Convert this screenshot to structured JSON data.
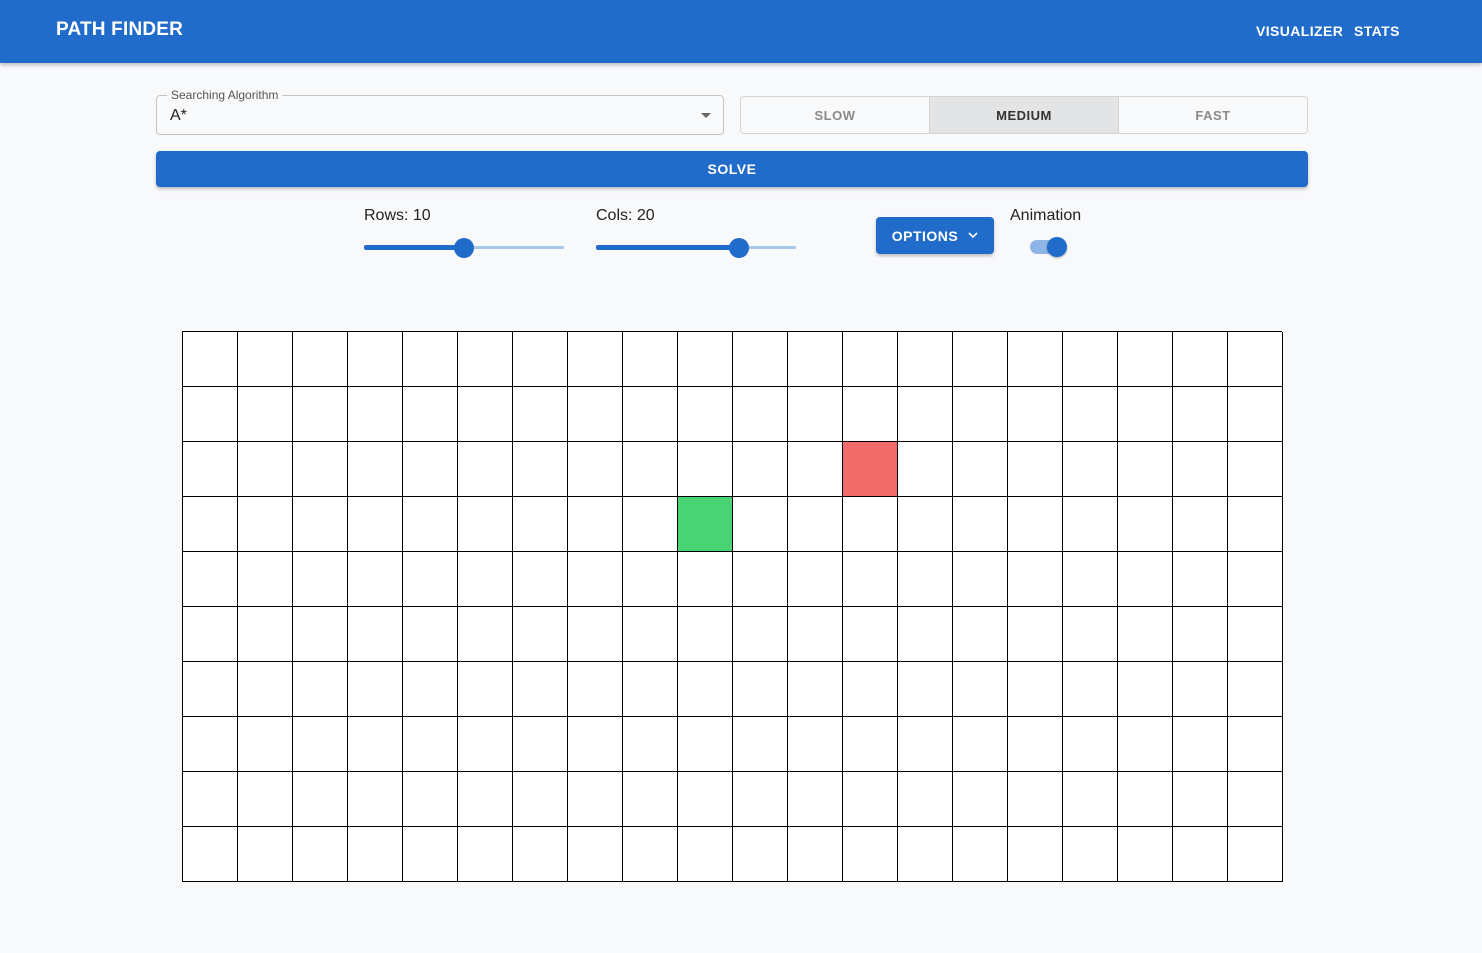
{
  "app": {
    "title": "PATH FINDER",
    "nav": [
      "VISUALIZER",
      "STATS"
    ]
  },
  "algorithm": {
    "label": "Searching Algorithm",
    "value": "A*"
  },
  "speed": {
    "options": [
      "SLOW",
      "MEDIUM",
      "FAST"
    ],
    "selected": "MEDIUM"
  },
  "solve_label": "SOLVE",
  "rows": {
    "label": "Rows: 10",
    "value": 10,
    "min": 0,
    "max": 20
  },
  "cols": {
    "label": "Cols: 20",
    "value": 20,
    "min": 0,
    "max": 28
  },
  "options_label": "OPTIONS",
  "animation": {
    "label": "Animation",
    "enabled": true
  },
  "grid": {
    "rows": 10,
    "cols": 20,
    "start": {
      "row": 3,
      "col": 9
    },
    "end": {
      "row": 2,
      "col": 12
    }
  },
  "colors": {
    "primary": "#216ccb",
    "start": "#4ad375",
    "end": "#f26a6a"
  }
}
